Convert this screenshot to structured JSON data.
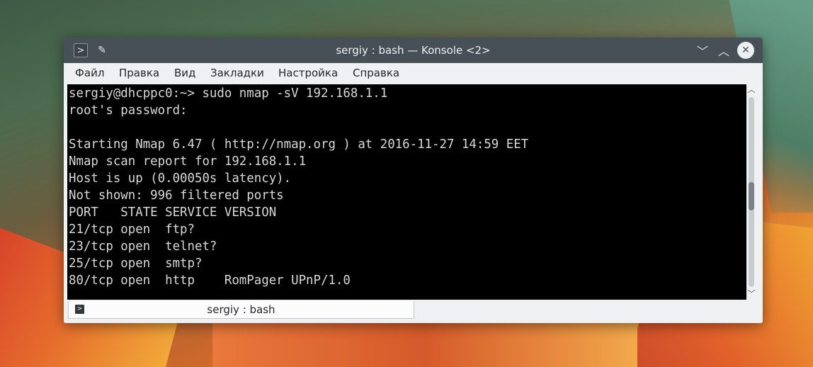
{
  "window": {
    "title": "sergiy : bash — Konsole <2>",
    "menu_icon": "terminal-menu-icon",
    "pin_icon": "pin-icon",
    "minimize_glyph": "﹀",
    "maximize_glyph": "︿",
    "close_glyph": "✕"
  },
  "menubar": {
    "items": [
      "Файл",
      "Правка",
      "Вид",
      "Закладки",
      "Настройка",
      "Справка"
    ]
  },
  "terminal": {
    "lines": [
      "sergiy@dhcppc0:~> sudo nmap -sV 192.168.1.1",
      "root's password:",
      "",
      "Starting Nmap 6.47 ( http://nmap.org ) at 2016-11-27 14:59 EET",
      "Nmap scan report for 192.168.1.1",
      "Host is up (0.00050s latency).",
      "Not shown: 996 filtered ports",
      "PORT   STATE SERVICE VERSION",
      "21/tcp open  ftp?",
      "23/tcp open  telnet?",
      "25/tcp open  smtp?",
      "80/tcp open  http    RomPager UPnP/1.0"
    ]
  },
  "tabs": [
    {
      "label": "sergiy : bash",
      "icon": "terminal-icon"
    }
  ],
  "scrollbar": {
    "up_glyph": "︿",
    "down_glyph": "﹀"
  }
}
